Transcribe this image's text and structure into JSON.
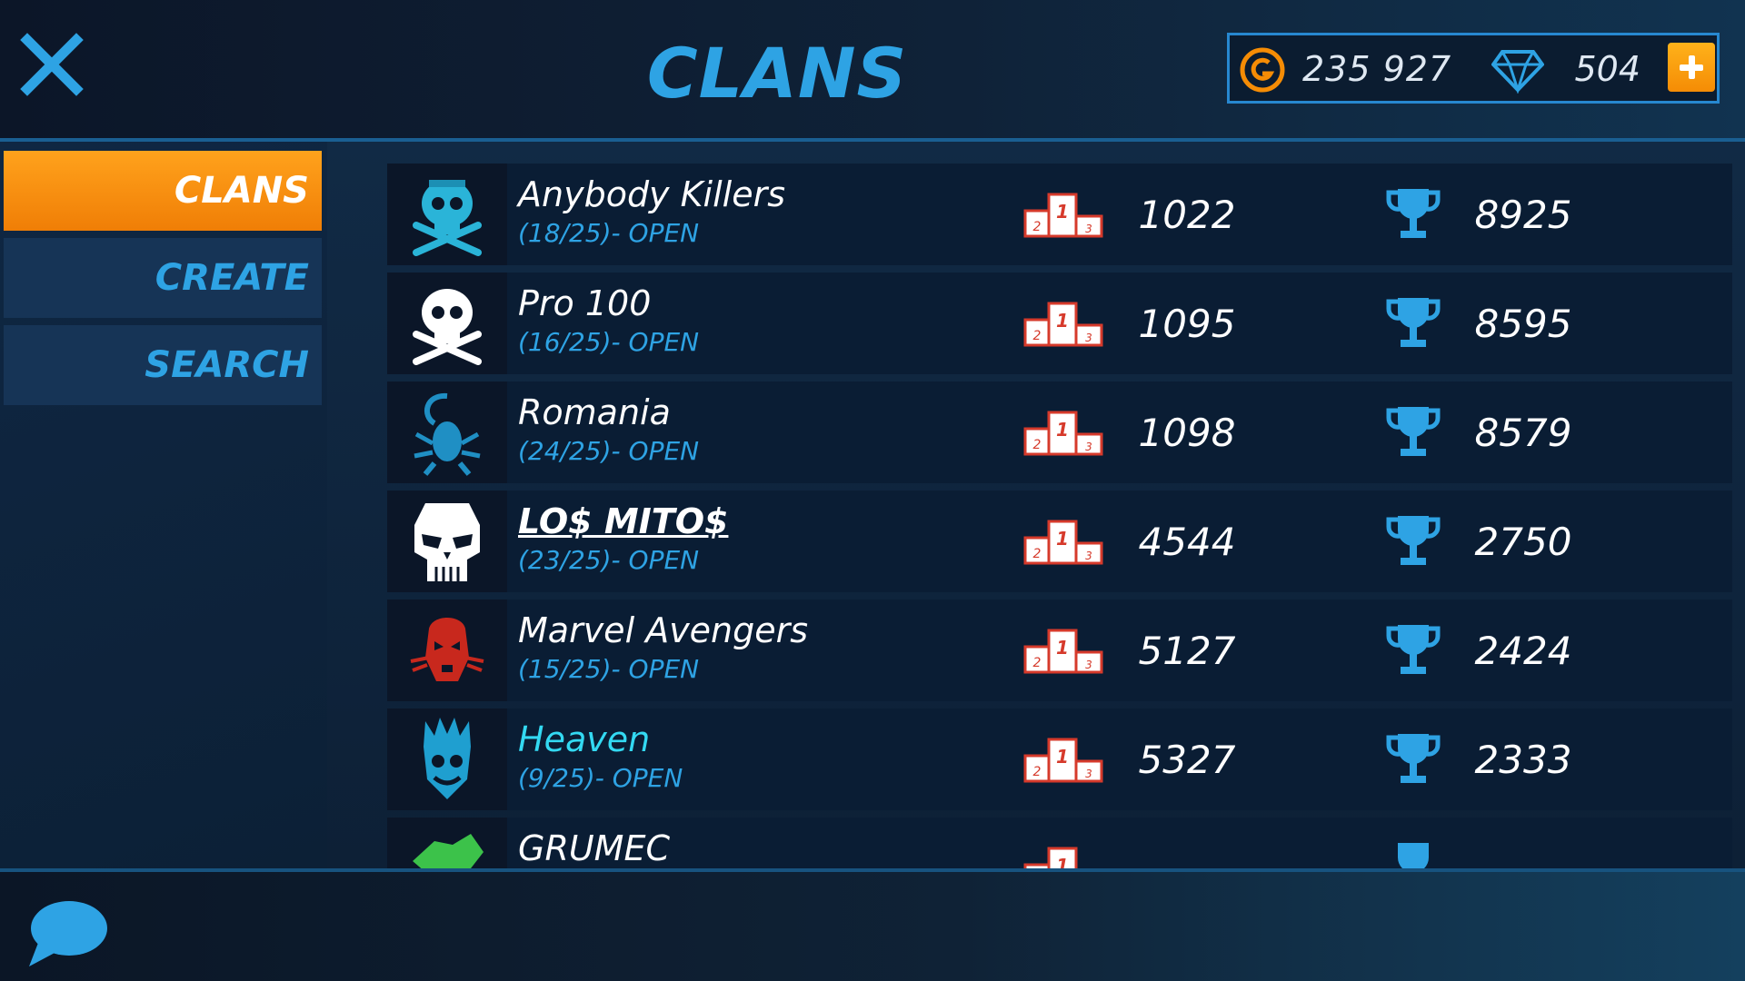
{
  "header": {
    "title": "CLANS",
    "close_icon": "close-icon"
  },
  "currency": {
    "gold_icon": "gold-coin-icon",
    "gold_amount": "235 927",
    "gem_icon": "diamond-icon",
    "gem_amount": "504",
    "add_icon": "plus-icon"
  },
  "sidebar": {
    "items": [
      {
        "label": "CLANS",
        "active": true
      },
      {
        "label": "CREATE",
        "active": false
      },
      {
        "label": "SEARCH",
        "active": false
      }
    ]
  },
  "clans": [
    {
      "name": "Anybody Killers",
      "status": "(18/25)- OPEN",
      "rank": "1022",
      "trophies": "8925",
      "emblem": "skull-crossbones-icon"
    },
    {
      "name": "Pro 100",
      "status": "(16/25)- OPEN",
      "rank": "1095",
      "trophies": "8595",
      "emblem": "skull-crossbones-icon"
    },
    {
      "name": "Romania",
      "status": "(24/25)- OPEN",
      "rank": "1098",
      "trophies": "8579",
      "emblem": "scorpion-icon"
    },
    {
      "name": "LO$ MITO$",
      "status": "(23/25)- OPEN",
      "rank": "4544",
      "trophies": "2750",
      "emblem": "punisher-skull-icon"
    },
    {
      "name": "Marvel Avengers",
      "status": "(15/25)- OPEN",
      "rank": "5127",
      "trophies": "2424",
      "emblem": "red-mask-icon"
    },
    {
      "name": "Heaven",
      "status": "(9/25)- OPEN",
      "rank": "5327",
      "trophies": "2333",
      "emblem": "clown-icon"
    },
    {
      "name": "GRUMEC",
      "status": "",
      "rank": "",
      "trophies": "",
      "emblem": "green-dragon-icon"
    }
  ],
  "icons": {
    "rank": "podium-icon",
    "trophies": "trophy-icon",
    "chat": "chat-bubble-icon"
  },
  "colors": {
    "accent_blue": "#2ea3e4",
    "active_orange": "#f59411",
    "highlight_cyan": "#33d9f2"
  }
}
